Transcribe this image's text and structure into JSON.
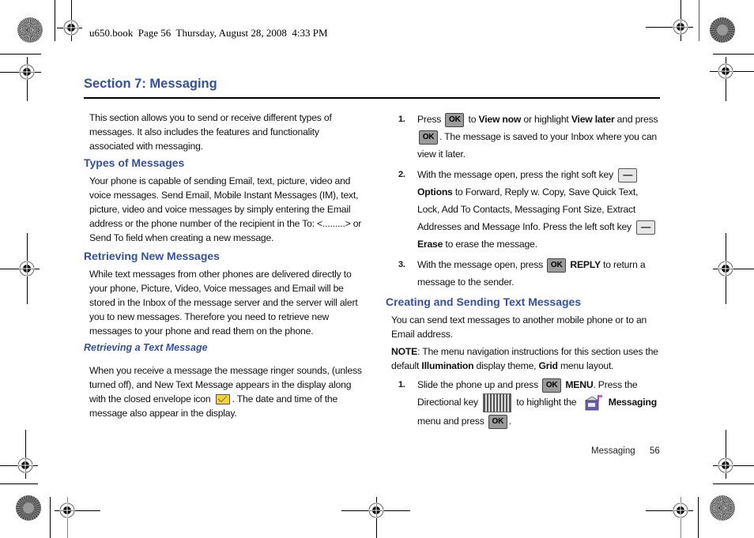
{
  "slug": "u650.book  Page 56  Thursday, August 28, 2008  4:33 PM",
  "section_title": "Section 7:  Messaging",
  "left": {
    "intro": "This section allows you to send or receive different types of messages. It also includes the features and functionality associated with messaging.",
    "types_heading": "Types of Messages",
    "types_body": "Your phone is capable of sending Email, text, picture, video and voice messages. Send Email, Mobile Instant Messages (IM), text, picture, video and voice messages by simply entering the Email address or the phone number of the recipient in the To: <.........> or Send To field when creating a new message.",
    "retrieving_heading": "Retrieving New Messages",
    "retrieving_body": "While text messages from other phones are delivered directly to your phone, Picture, Video, Voice messages and Email will be stored in the Inbox of the message server and the server will alert you to new messages. Therefore you need to retrieve new messages to your phone and read them on the phone.",
    "text_msg_heading": "Retrieving a Text Message",
    "text_msg_body_a": "When you receive a message the message ringer sounds, (unless turned off), and New Text Message appears in the display along with the closed envelope icon",
    "text_msg_body_b": ". The date and time of the message also appear in the display."
  },
  "right": {
    "steps": [
      {
        "num": "1.",
        "t1": "Press",
        "b1": "View now",
        "t2": " or highlight ",
        "b2": "View later",
        "t3": " and press",
        "t4": ". The message is saved to your Inbox where you can view it later."
      },
      {
        "num": "2.",
        "t1": "With the message open, press the right soft key",
        "b1": "Options",
        "t2": " to Forward, Reply w. Copy, Save Quick Text, Lock, Add To Contacts, Messaging Font Size, Extract Addresses and Message Info. Press the left soft key",
        "b2": "Erase",
        "t3": " to erase the message."
      },
      {
        "num": "3.",
        "t1": "With the message open, press",
        "b1": "REPLY",
        "t2": " to return a message to the sender."
      }
    ],
    "creating_heading": "Creating and Sending Text Messages",
    "creating_body": "You can send text messages to another mobile phone or to an Email address.",
    "note_label": "NOTE",
    "note_t1": ": The menu navigation instructions for this section uses the default ",
    "note_b1": "Illumination",
    "note_t2": " display theme, ",
    "note_b2": "Grid",
    "note_t3": " menu layout.",
    "create_step": {
      "num": "1.",
      "t1": "Slide the phone up and press",
      "b1": "MENU",
      "t2": ". Press the Directional key",
      "t3": " to highlight the",
      "b2": "Messaging",
      "t4": " menu and press",
      "t5": "."
    }
  },
  "keys": {
    "ok": "OK",
    "soft": "—"
  },
  "footer": {
    "label": "Messaging",
    "page": "56"
  },
  "colors": {
    "heading": "#3550a3",
    "ok_key": "#9b9b9b"
  }
}
